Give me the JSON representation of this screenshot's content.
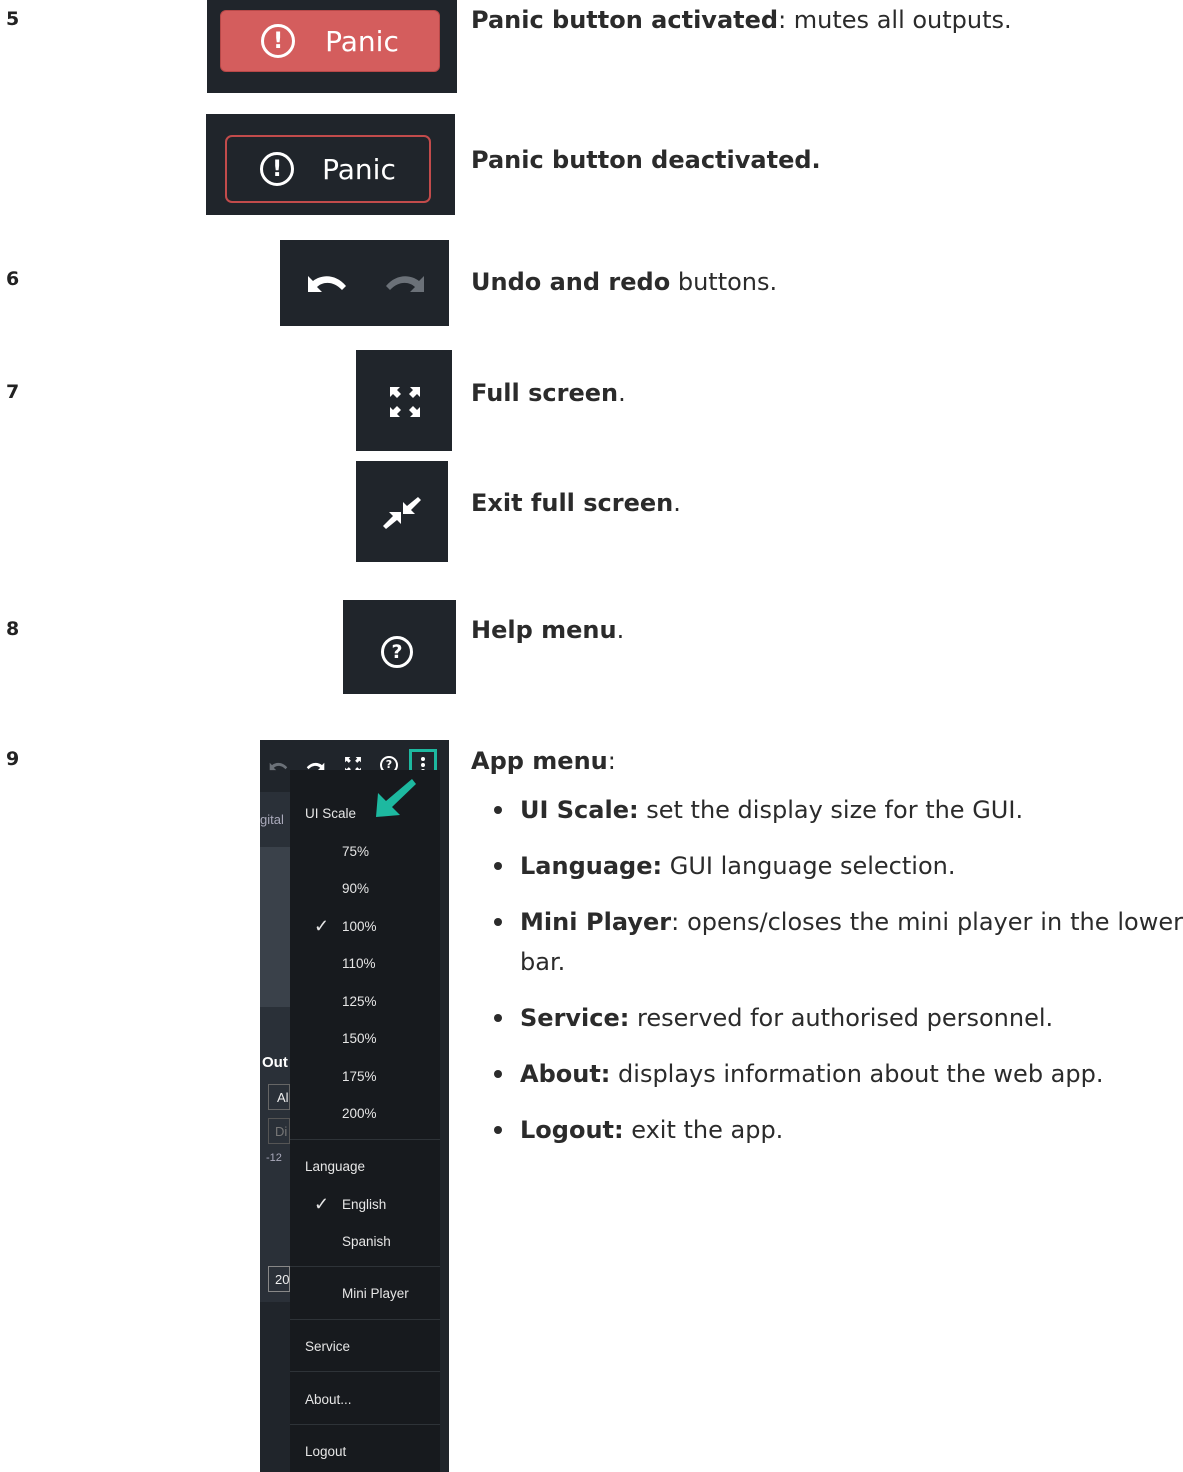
{
  "rows": {
    "r5": {
      "number": "5",
      "panic_label": "Panic",
      "activated_title": "Panic button activated",
      "activated_text": ": mutes all outputs.",
      "deactivated_title": "Panic button deactivated."
    },
    "r6": {
      "number": "6",
      "title": "Undo and redo",
      "text": " buttons."
    },
    "r7": {
      "number": "7",
      "full_title": "Full screen",
      "full_text": ".",
      "exit_title": "Exit full screen",
      "exit_text": "."
    },
    "r8": {
      "number": "8",
      "title": "Help menu",
      "text": "."
    },
    "r9": {
      "number": "9",
      "title": "App menu",
      "text": ":",
      "bullets": [
        {
          "term": "UI Scale:",
          "text": " set the display size for the GUI."
        },
        {
          "term": "Language:",
          "text": " GUI language selection."
        },
        {
          "term": "Mini Player",
          "text": ": opens/closes the mini player in the lower bar."
        },
        {
          "term": "Service:",
          "text": " reserved for authorised personnel."
        },
        {
          "term": "About:",
          "text": " displays information about the web app."
        },
        {
          "term": "Logout:",
          "text": " exit the app."
        }
      ]
    }
  },
  "app_menu": {
    "ui_scale_header": "UI Scale",
    "scales": [
      "75%",
      "90%",
      "100%",
      "110%",
      "125%",
      "150%",
      "175%",
      "200%"
    ],
    "selected_scale": "100%",
    "language_header": "Language",
    "languages": [
      "English",
      "Spanish"
    ],
    "selected_language": "English",
    "mini_player": "Mini Player",
    "service": "Service",
    "about": "About...",
    "logout": "Logout",
    "bg_fragments": [
      "gital",
      "Out",
      "Al",
      "Di",
      "-12",
      "20"
    ]
  },
  "colors": {
    "panel": "#20252b",
    "panic_active": "#d45d5d",
    "panic_border": "#c24b4b",
    "highlight": "#1db9a0"
  }
}
